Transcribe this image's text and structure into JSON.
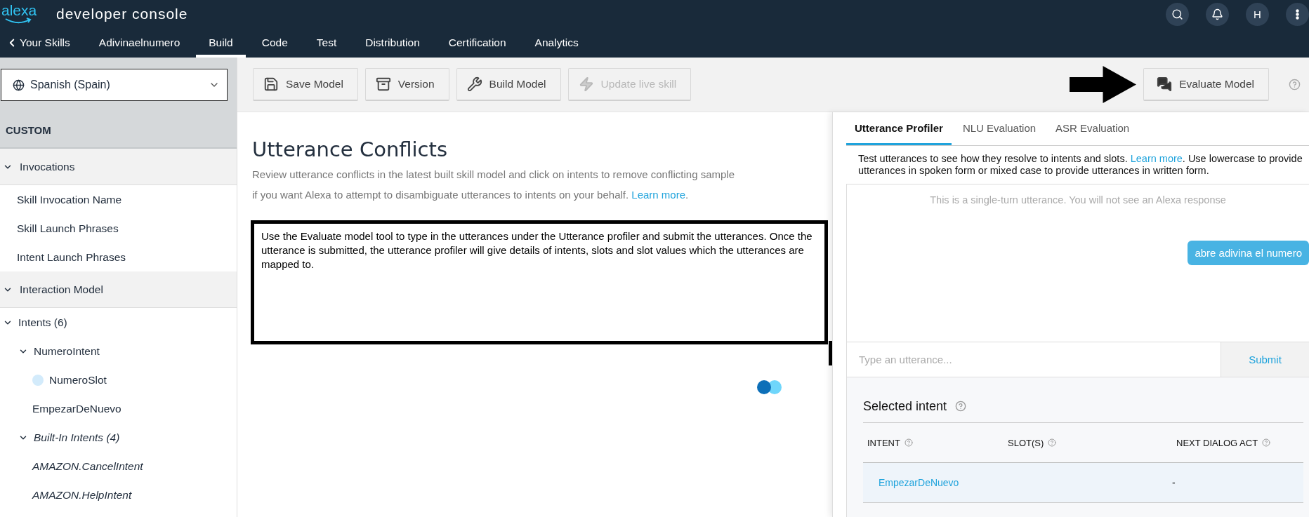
{
  "header": {
    "logo": "alexa",
    "title": "developer console",
    "avatar": "H"
  },
  "nav": [
    {
      "label": "Your Skills",
      "kind": "back",
      "selected": false
    },
    {
      "label": "Adivinaelnumero",
      "kind": "link",
      "selected": false
    },
    {
      "label": "Build",
      "kind": "link",
      "selected": true
    },
    {
      "label": "Code",
      "kind": "link",
      "selected": false
    },
    {
      "label": "Test",
      "kind": "link",
      "selected": false
    },
    {
      "label": "Distribution",
      "kind": "link",
      "selected": false
    },
    {
      "label": "Certification",
      "kind": "link",
      "selected": false
    },
    {
      "label": "Analytics",
      "kind": "link",
      "selected": false
    }
  ],
  "sidebar": {
    "locale": "Spanish (Spain)",
    "heading": "CUSTOM",
    "sections": [
      {
        "label": "Invocations",
        "expanded": true,
        "items": [
          {
            "label": "Skill Invocation Name"
          },
          {
            "label": "Skill Launch Phrases"
          },
          {
            "label": "Intent Launch Phrases"
          }
        ]
      },
      {
        "label": "Interaction Model",
        "expanded": true,
        "items": [
          {
            "label": "Intents (6)",
            "expanded": true,
            "children": [
              {
                "label": "NumeroIntent",
                "expanded": true,
                "children": [
                  {
                    "label": "NumeroSlot",
                    "kind": "slot"
                  }
                ]
              },
              {
                "label": "EmpezarDeNuevo"
              },
              {
                "label": "Built-In Intents (4)",
                "kind": "builtin",
                "expanded": true,
                "children": [
                  {
                    "label": "AMAZON.CancelIntent",
                    "kind": "builtin"
                  },
                  {
                    "label": "AMAZON.HelpIntent",
                    "kind": "builtin"
                  }
                ]
              }
            ]
          }
        ]
      }
    ]
  },
  "toolbar": {
    "buttons": [
      {
        "label": "Save Model",
        "kind": "save",
        "disabled": false
      },
      {
        "label": "Version",
        "kind": "version",
        "disabled": false
      },
      {
        "label": "Build Model",
        "kind": "build",
        "disabled": false
      },
      {
        "label": "Update live skill",
        "kind": "update",
        "disabled": true
      }
    ],
    "evaluate": "Evaluate Model"
  },
  "main": {
    "title": "Utterance Conflicts",
    "line_1": "Review utterance conflicts in the latest built skill model and click on intents to remove conflicting sample",
    "line_2": "if you want Alexa to attempt to disambiguate utterances to intents on your behalf.",
    "link": "Learn more",
    "suffix": "."
  },
  "annotation": {
    "text": "Use the Evaluate model tool to type in the utterances under the Utterance profiler and submit the utterances. Once the utterance is submitted, the utterance profiler will give details of intents, slots and slot values which the utterances are mapped to."
  },
  "panel": {
    "tabs": [
      {
        "label": "Utterance Profiler",
        "selected": true
      },
      {
        "label": "NLU Evaluation",
        "selected": false
      },
      {
        "label": "ASR Evaluation",
        "selected": false
      }
    ],
    "info_before": "Test utterances to see how they resolve to intents and slots.",
    "info_link": "Learn more",
    "info_after": ". Use lowercase to provide utterances in spoken form or mixed case to provide utterances in written form.",
    "notice": "This is a single-turn utterance. You will not see an Alexa response",
    "bubble": "abre adivina el numero",
    "input": {
      "placeholder": "Type an utterance..."
    },
    "submit": "Submit",
    "selected_title": "Selected intent",
    "columns": [
      "INTENT",
      "SLOT(S)",
      "NEXT DIALOG ACT"
    ],
    "rows": [
      {
        "intent": "EmpezarDeNuevo",
        "next_dialog_act": "-"
      }
    ]
  }
}
